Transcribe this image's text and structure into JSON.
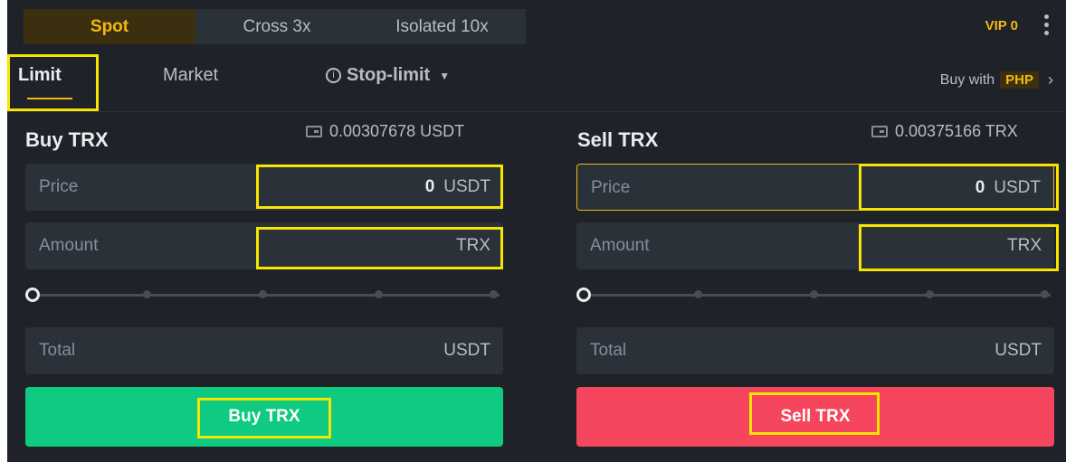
{
  "margin_tabs": {
    "spot": "Spot",
    "cross_label": "Cross",
    "cross_x": "3x",
    "isolated_label": "Isolated",
    "isolated_x": "10x"
  },
  "vip": "VIP 0",
  "order_tabs": {
    "limit": "Limit",
    "market": "Market",
    "stop_limit": "Stop-limit"
  },
  "buy_with": {
    "prefix": "Buy with",
    "currency": "PHP"
  },
  "buy": {
    "title": "Buy TRX",
    "balance": "0.00307678 USDT",
    "price_label": "Price",
    "price_value": "0",
    "price_unit": "USDT",
    "amount_label": "Amount",
    "amount_unit": "TRX",
    "total_label": "Total",
    "total_unit": "USDT",
    "button": "Buy TRX"
  },
  "sell": {
    "title": "Sell TRX",
    "balance": "0.00375166 TRX",
    "price_label": "Price",
    "price_value": "0",
    "price_unit": "USDT",
    "amount_label": "Amount",
    "amount_unit": "TRX",
    "total_label": "Total",
    "total_unit": "USDT",
    "button": "Sell TRX"
  },
  "colors": {
    "accent": "#f0b90b",
    "buy": "#0ecb81",
    "sell": "#f6465d",
    "highlight": "#f5e500"
  }
}
